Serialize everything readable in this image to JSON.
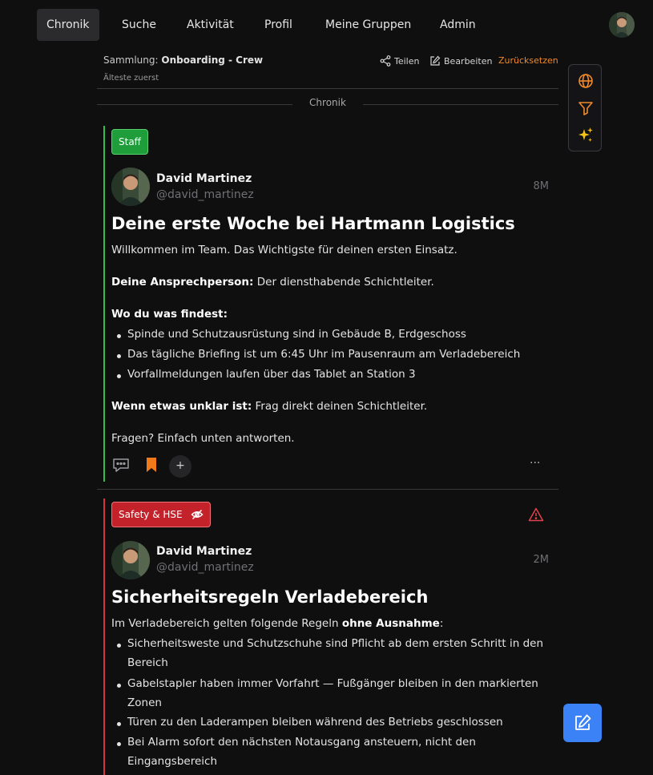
{
  "nav": {
    "items": [
      {
        "label": "Chronik",
        "active": true
      },
      {
        "label": "Suche",
        "active": false
      },
      {
        "label": "Aktivität",
        "active": false
      },
      {
        "label": "Profil",
        "active": false
      },
      {
        "label": "Meine Gruppen",
        "active": false
      },
      {
        "label": "Admin",
        "active": false
      }
    ]
  },
  "collection": {
    "prefix": "Sammlung:",
    "name": "Onboarding - Crew",
    "sort": "Älteste zuerst",
    "share_label": "Teilen",
    "edit_label": "Bearbeiten",
    "reset_label": "Zurücksetzen"
  },
  "divider": {
    "label": "Chronik"
  },
  "side_tools": {
    "icons": [
      "globe-icon",
      "filter-icon",
      "sparkles-icon"
    ],
    "colors": {
      "globe": "#f08a2a",
      "filter": "#f08a2a",
      "sparkles": "#f5c518"
    }
  },
  "posts": [
    {
      "tag": "Staff",
      "tag_color": "#1f9d3a",
      "author": "David Martinez",
      "handle": "@david_martinez",
      "time": "8M",
      "title": "Deine erste Woche bei Hartmann Logistics",
      "intro": "Willkommen im Team. Das Wichtigste für deinen ersten Einsatz.",
      "contact_label": "Deine Ansprechperson:",
      "contact_text": " Der diensthabende Schichtleiter.",
      "where_label": "Wo du was findest:",
      "bullets": [
        "Spinde und Schutzausrüstung sind in Gebäude B, Erdgeschoss",
        "Das tägliche Briefing ist um 6:45 Uhr im Pausenraum am Verladebereich",
        "Vorfallmeldungen laufen über das Tablet an Station 3"
      ],
      "unclear_label": "Wenn etwas unklar ist:",
      "unclear_text": " Frag direkt deinen Schichtleiter.",
      "outro": "Fragen? Einfach unten antworten.",
      "plus_label": "+",
      "more_label": "···"
    },
    {
      "tag": "Safety & HSE",
      "tag_color": "#c4222b",
      "author": "David Martinez",
      "handle": "@david_martinez",
      "time": "2M",
      "title": "Sicherheitsregeln Verladebereich",
      "intro_prefix": "Im Verladebereich gelten folgende Regeln ",
      "intro_bold": "ohne Ausnahme",
      "intro_suffix": ":",
      "bullets": [
        [
          "Sicherheitsweste und Schutzschuhe sind Pflicht ab dem ersten Schritt in den",
          "Bereich"
        ],
        [
          "Gabelstapler haben immer Vorfahrt — Fußgänger bleiben in den markierten",
          "Zonen"
        ],
        [
          "Türen zu den Laderampen bleiben während des Betriebs geschlossen"
        ],
        [
          "Bei Alarm sofort den nächsten Notausgang ansteuern, nicht den",
          "Eingangsbereich"
        ]
      ]
    }
  ],
  "fab": {
    "icon": "compose-icon",
    "color": "#3b82f6"
  }
}
